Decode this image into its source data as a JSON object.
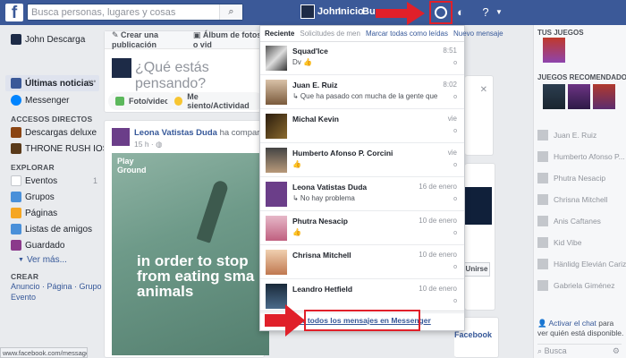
{
  "header": {
    "search_placeholder": "Busca personas, lugares y cosas",
    "user_name": "John",
    "home_label": "Inicio",
    "find_friends_label": "Bus"
  },
  "leftnav": {
    "profile_name": "John Descarga",
    "news_feed": "Últimas noticias",
    "messenger": "Messenger",
    "shortcuts_heading": "ACCESOS DIRECTOS",
    "shortcuts": [
      "Descargas deluxe",
      "THRONE RUSH IOS..."
    ],
    "explore_heading": "EXPLORAR",
    "explore": [
      {
        "label": "Eventos",
        "count": "1"
      },
      {
        "label": "Grupos",
        "count": ""
      },
      {
        "label": "Páginas",
        "count": ""
      },
      {
        "label": "Listas de amigos",
        "count": ""
      },
      {
        "label": "Guardado",
        "count": ""
      }
    ],
    "see_more": "Ver más...",
    "create_heading": "CREAR",
    "create_links_1": "Anuncio · Página · Grupo",
    "create_links_2": "Evento"
  },
  "composer": {
    "create_post": "Crear una publicación",
    "album": "Álbum de fotos o vid",
    "placeholder": "¿Qué estás pensando?",
    "photo_video": "Foto/video",
    "feeling": "Me siento/Actividad"
  },
  "post": {
    "author": "Leona Vatistas Duda",
    "shared": "ha compartido el vi",
    "time": "15 h",
    "video_brand_1": "Play",
    "video_brand_2": "Ground",
    "video_caption_1": "in order to stop",
    "video_caption_2": "from eating sma",
    "video_caption_3": "animals"
  },
  "messages": {
    "tab_recent": "Reciente",
    "tab_requests": "Solicitudes de men",
    "mark_all_read": "Marcar todas como leídas",
    "new_message": "Nuevo mensaje",
    "items": [
      {
        "name": "Squad'Ice",
        "preview": "Dv",
        "time": "8:51"
      },
      {
        "name": "Juan E. Ruiz",
        "preview": "↳ Que ha pasado con mucha de la gente que estaba en n",
        "time": "8:02"
      },
      {
        "name": "Michal Kevin",
        "preview": "",
        "time": "vie"
      },
      {
        "name": "Humberto Afonso P. Corcini",
        "preview": "",
        "time": "vie"
      },
      {
        "name": "Leona Vatistas Duda",
        "preview": "↳ No hay problema",
        "time": "16 de enero"
      },
      {
        "name": "Phutra Nesacip",
        "preview": "",
        "time": "10 de enero"
      },
      {
        "name": "Chrisna Mitchell",
        "preview": "",
        "time": "10 de enero"
      },
      {
        "name": "Leandro Hetfield",
        "preview": "",
        "time": "10 de enero"
      }
    ],
    "see_all": "Ver todos los mensajes en Messenger"
  },
  "rightcol": {
    "games_heading": "TUS JUEGOS",
    "recommended_heading": "JUEGOS RECOMENDADOS",
    "contacts": [
      "Juan E. Ruiz",
      "Humberto Afonso P...",
      "Phutra Nesacip",
      "Chrisna Mitchell",
      "Anis Caftanes",
      "Kid Vibe",
      "Hänlidg Elevián Cariz",
      "Gabriela Giménez"
    ],
    "chat_text_1": "Activar el chat",
    "chat_text_2": " para ver quién está disponible.",
    "search": "Busca"
  },
  "midcol": {
    "button": "Unirse",
    "banner": "Facebook"
  },
  "statusbar": "www.facebook.com/messages/t/",
  "colors": {
    "fb_blue": "#3b5998",
    "link": "#365899",
    "highlight_red": "#e0202a"
  }
}
